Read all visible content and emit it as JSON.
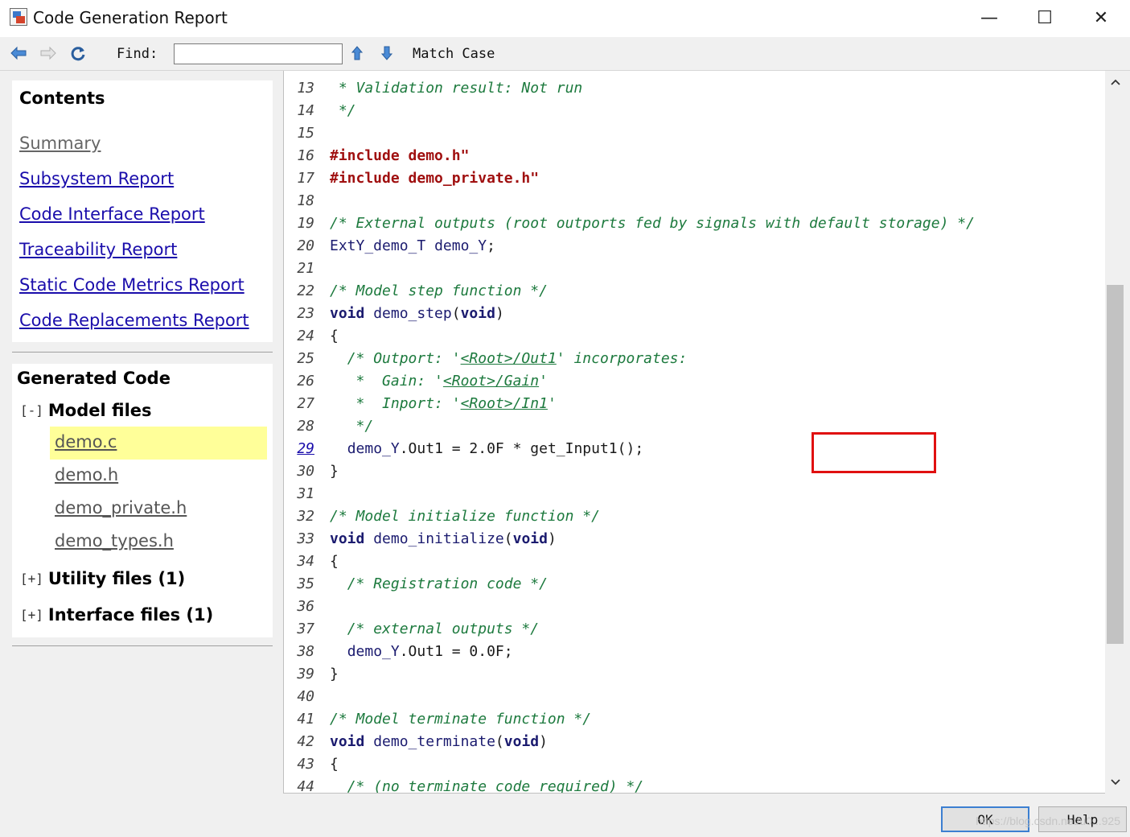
{
  "window": {
    "title": "Code Generation Report",
    "controls": {
      "minimize": "—",
      "maximize": "☐",
      "close": "✕"
    }
  },
  "toolbar": {
    "back_icon": "back-arrow-icon",
    "forward_icon": "forward-arrow-icon",
    "refresh_icon": "refresh-icon",
    "find_label": "Find:",
    "find_value": "",
    "up_icon": "arrow-up-icon",
    "down_icon": "arrow-down-icon",
    "match_case_label": "Match Case"
  },
  "contents": {
    "heading": "Contents",
    "links": [
      "Summary",
      "Subsystem Report",
      "Code Interface Report",
      "Traceability Report",
      "Static Code Metrics Report",
      "Code Replacements Report"
    ]
  },
  "generated_code": {
    "heading": "Generated Code",
    "groups": [
      {
        "toggle": "[-]",
        "label": "Model files",
        "files": [
          "demo.c",
          "demo.h",
          "demo_private.h",
          "demo_types.h"
        ],
        "selected": "demo.c"
      },
      {
        "toggle": "[+]",
        "label": "Utility files (1)"
      },
      {
        "toggle": "[+]",
        "label": "Interface files (1)"
      }
    ]
  },
  "code": {
    "lines": [
      {
        "n": "13",
        "text": " * Validation result: Not run"
      },
      {
        "n": "14",
        "text": " */"
      },
      {
        "n": "15",
        "text": ""
      },
      {
        "n": "16",
        "text": "#include \"demo.h\""
      },
      {
        "n": "17",
        "text": "#include \"demo_private.h\""
      },
      {
        "n": "18",
        "text": ""
      },
      {
        "n": "19",
        "text": "/* External outputs (root outports fed by signals with default storage) */"
      },
      {
        "n": "20",
        "text": "ExtY_demo_T demo_Y;"
      },
      {
        "n": "21",
        "text": ""
      },
      {
        "n": "22",
        "text": "/* Model step function */"
      },
      {
        "n": "23",
        "text": "void demo_step(void)"
      },
      {
        "n": "24",
        "text": "{"
      },
      {
        "n": "25",
        "text": "  /* Outport: '<Root>/Out1' incorporates:"
      },
      {
        "n": "26",
        "text": "   *  Gain: '<Root>/Gain'"
      },
      {
        "n": "27",
        "text": "   *  Inport: '<Root>/In1'"
      },
      {
        "n": "28",
        "text": "   */"
      },
      {
        "n": "29",
        "text": "  demo_Y.Out1 = 2.0F * get_Input1();"
      },
      {
        "n": "30",
        "text": "}"
      },
      {
        "n": "31",
        "text": ""
      },
      {
        "n": "32",
        "text": "/* Model initialize function */"
      },
      {
        "n": "33",
        "text": "void demo_initialize(void)"
      },
      {
        "n": "34",
        "text": "{"
      },
      {
        "n": "35",
        "text": "  /* Registration code */"
      },
      {
        "n": "36",
        "text": ""
      },
      {
        "n": "37",
        "text": "  /* external outputs */"
      },
      {
        "n": "38",
        "text": "  demo_Y.Out1 = 0.0F;"
      },
      {
        "n": "39",
        "text": "}"
      },
      {
        "n": "40",
        "text": ""
      },
      {
        "n": "41",
        "text": "/* Model terminate function */"
      },
      {
        "n": "42",
        "text": "void demo_terminate(void)"
      },
      {
        "n": "43",
        "text": "{"
      },
      {
        "n": "44",
        "text": "  /* (no terminate code required) */"
      }
    ],
    "linked_line": "29"
  },
  "buttons": {
    "ok": "OK",
    "help": "Help"
  },
  "watermark": "https://blog.csdn.net/u0...925",
  "colors": {
    "comment": "#1d7a3e",
    "keyword": "#1b1b6f",
    "include": "#a01010",
    "link": "#1a0dab",
    "highlight_box": "#e01010",
    "selected_file_bg": "#ffff99"
  }
}
